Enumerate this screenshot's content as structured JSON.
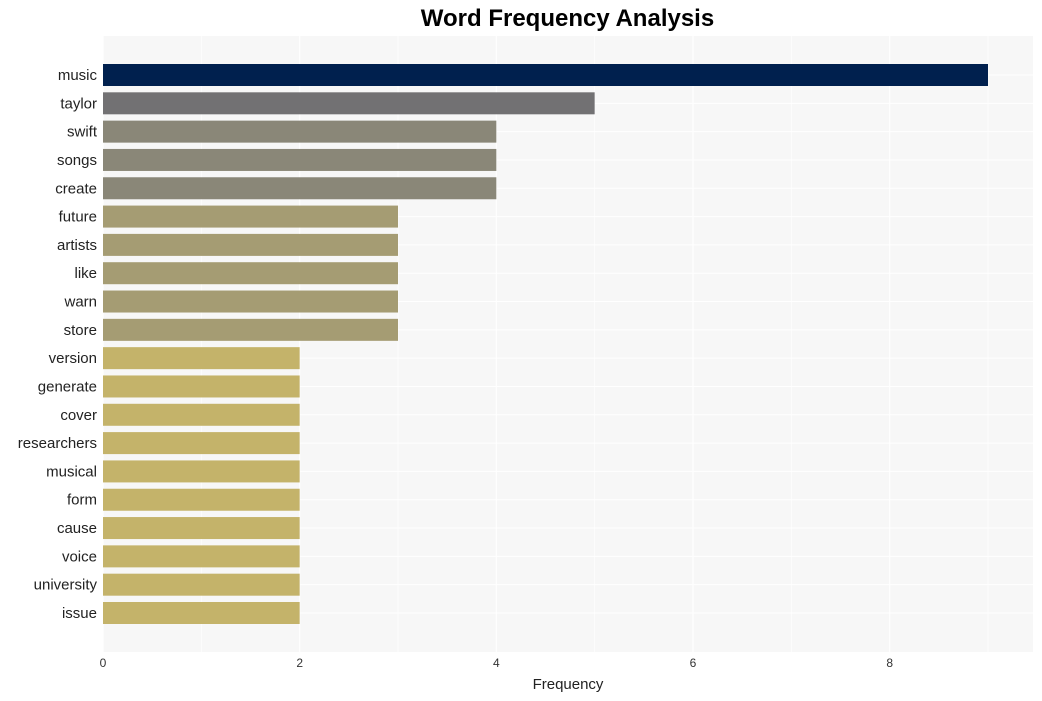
{
  "chart_data": {
    "type": "bar",
    "orientation": "horizontal",
    "title": "Word Frequency Analysis",
    "xlabel": "Frequency",
    "ylabel": "",
    "xlim": [
      0,
      9.45
    ],
    "xticks": [
      0,
      2,
      4,
      6,
      8
    ],
    "grid": true,
    "legend": "none",
    "categories": [
      "music",
      "taylor",
      "swift",
      "songs",
      "create",
      "future",
      "artists",
      "like",
      "warn",
      "store",
      "version",
      "generate",
      "cover",
      "researchers",
      "musical",
      "form",
      "cause",
      "voice",
      "university",
      "issue"
    ],
    "values": [
      9,
      5,
      4,
      4,
      4,
      3,
      3,
      3,
      3,
      3,
      2,
      2,
      2,
      2,
      2,
      2,
      2,
      2,
      2,
      2
    ],
    "colors": {
      "9": "#00204e",
      "5": "#727173",
      "4": "#8a8778",
      "3": "#a59c73",
      "2": "#c4b36a"
    },
    "plot_background": "#f7f7f7",
    "grid_color": "#ffffff"
  }
}
